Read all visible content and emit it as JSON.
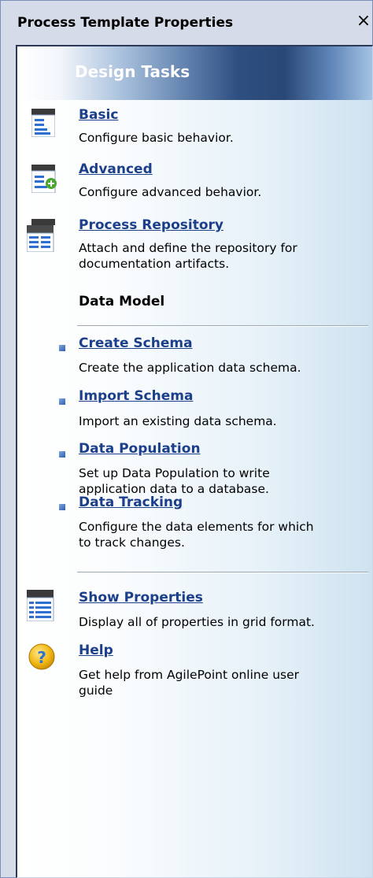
{
  "window": {
    "title": "Process Template Properties",
    "close_glyph": "×"
  },
  "panel": {
    "header": "Design Tasks"
  },
  "tasks": [
    {
      "label": "Basic",
      "description": "Configure basic behavior.",
      "icon": "document-icon"
    },
    {
      "label": "Advanced",
      "description": "Configure advanced behavior.",
      "icon": "document-add-icon"
    },
    {
      "label": "Process Repository",
      "description_line1": "Attach and define the repository for",
      "description_line2": "documentation artifacts.",
      "icon": "repository-icon"
    }
  ],
  "data_model": {
    "title": "Data Model",
    "items": [
      {
        "label": "Create Schema",
        "description": "Create the application data schema."
      },
      {
        "label": "Import Schema",
        "description": "Import an existing data schema."
      },
      {
        "label": "Data Population",
        "description_line1": "Set up Data Population to write",
        "description_line2": "application data to a database."
      },
      {
        "label": "Data Tracking",
        "description_line1": "Configure the data elements for which",
        "description_line2": "to track changes."
      }
    ]
  },
  "footer_tasks": [
    {
      "label": "Show Properties",
      "description": "Display all of properties in grid format.",
      "icon": "grid-icon"
    },
    {
      "label": "Help",
      "description_line1": "Get help from AgilePoint online user",
      "description_line2": "guide",
      "icon": "help-icon"
    }
  ]
}
